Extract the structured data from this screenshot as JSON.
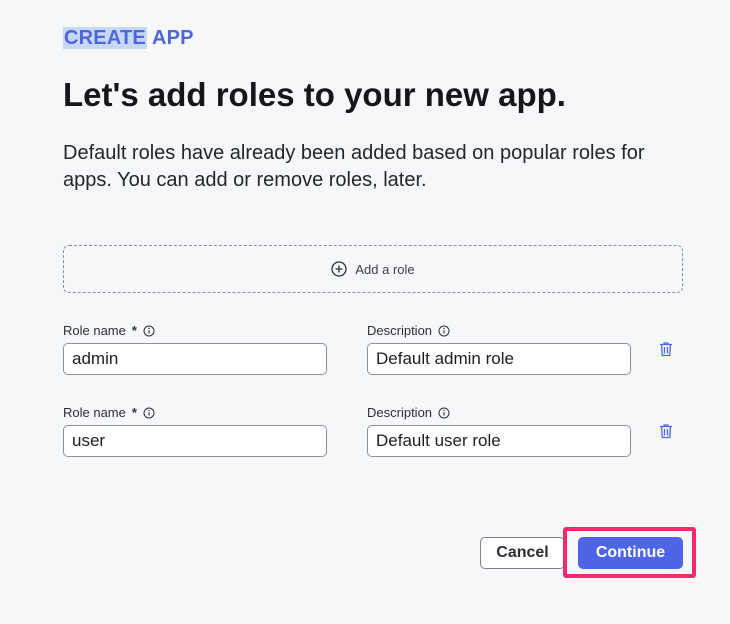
{
  "header": {
    "eyebrow_highlighted": "CREATE",
    "eyebrow_rest": "APP",
    "title": "Let's add roles to your new app.",
    "description": "Default roles have already been added based on popular roles for apps. You can add or remove roles, later."
  },
  "add_role": {
    "label": "Add a role",
    "icon": "plus-circle-icon"
  },
  "labels": {
    "role_name": "Role name",
    "required_marker": "*",
    "description": "Description"
  },
  "roles": [
    {
      "name": "admin",
      "description": "Default admin role"
    },
    {
      "name": "user",
      "description": "Default user role"
    }
  ],
  "actions": {
    "cancel_label": "Cancel",
    "continue_label": "Continue"
  },
  "colors": {
    "accent": "#4d65e6",
    "eyebrow_text": "#4f67dd",
    "eyebrow_highlight": "#c7d8f7",
    "focus_outline": "#f52a6b",
    "background": "#f6f7f9"
  }
}
